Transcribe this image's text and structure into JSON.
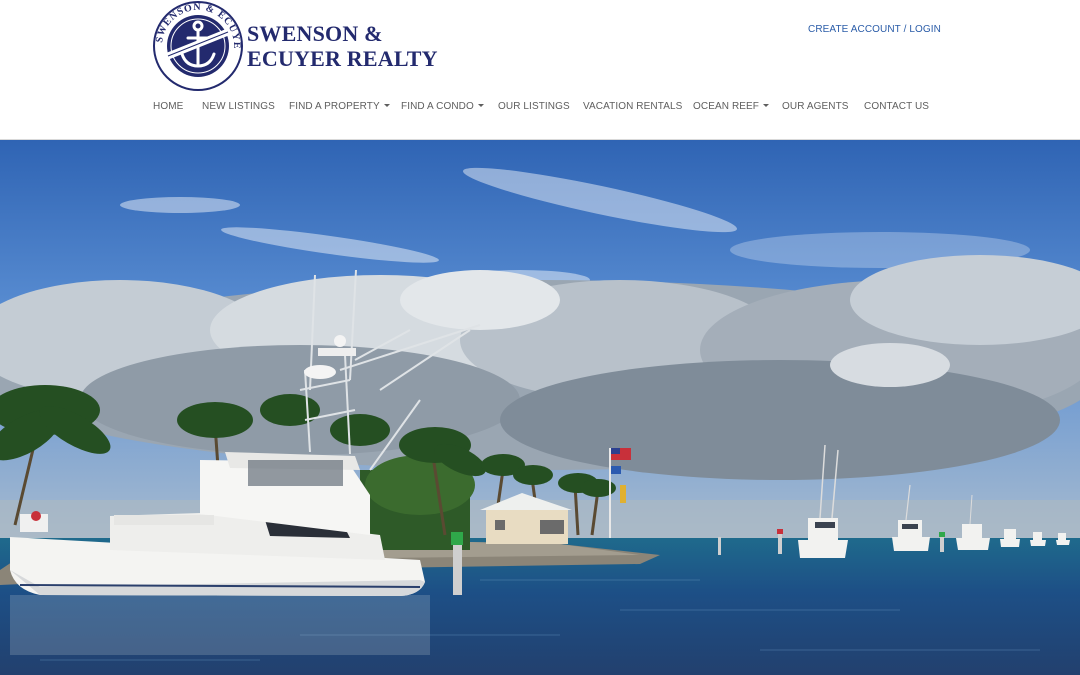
{
  "brand": {
    "name_line1": "SWENSON &",
    "name_line2": "ECUYER REALTY",
    "seal_text": "SWENSON & ECUYER REALTY",
    "brand_color": "#232a6e"
  },
  "header": {
    "account_link": "CREATE ACCOUNT / LOGIN"
  },
  "nav": {
    "items": [
      {
        "label": "HOME",
        "dropdown": false
      },
      {
        "label": "NEW LISTINGS",
        "dropdown": false
      },
      {
        "label": "FIND A PROPERTY",
        "dropdown": true
      },
      {
        "label": "FIND A CONDO",
        "dropdown": true
      },
      {
        "label": "OUR LISTINGS",
        "dropdown": false
      },
      {
        "label": "VACATION RENTALS",
        "dropdown": false
      },
      {
        "label": "OCEAN REEF",
        "dropdown": true
      },
      {
        "label": "OUR AGENTS",
        "dropdown": false
      },
      {
        "label": "CONTACT US",
        "dropdown": false
      }
    ]
  },
  "colors": {
    "link": "#2a5ca8",
    "nav_text": "#5e5e5e",
    "sky": "#3f78c8",
    "water": "#1f4f86"
  }
}
